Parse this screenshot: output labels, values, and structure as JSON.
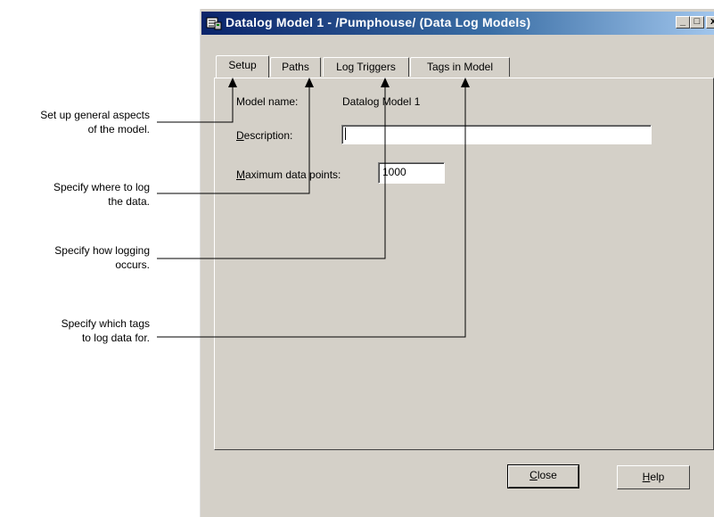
{
  "window": {
    "title": "Datalog Model 1 - /Pumphouse/ (Data Log Models)",
    "icon": "datalog-model-icon",
    "controls": {
      "minimize": "_",
      "maximize": "□",
      "close": "x"
    }
  },
  "tabs": [
    {
      "label": "Setup",
      "active": true
    },
    {
      "label": "Paths",
      "active": false
    },
    {
      "label": "Log Triggers",
      "active": false
    },
    {
      "label": "Tags in Model",
      "active": false
    }
  ],
  "setup": {
    "model_name_label": "Model name:",
    "model_name_value": "Datalog Model 1",
    "description_label_mnemonic": "D",
    "description_label_rest": "escription:",
    "description_value": "",
    "max_points_label_mnemonic": "M",
    "max_points_label_rest": "aximum data points:",
    "max_points_value": "1000"
  },
  "buttons": {
    "close_mnemonic": "C",
    "close_rest": "lose",
    "help_mnemonic": "H",
    "help_rest": "elp"
  },
  "callouts": [
    {
      "line1": "Set up general aspects",
      "line2": "of the model."
    },
    {
      "line1": "Specify where to log",
      "line2": "the data."
    },
    {
      "line1": "Specify how logging",
      "line2": "occurs."
    },
    {
      "line1": "Specify which tags",
      "line2": "to log data for."
    }
  ]
}
